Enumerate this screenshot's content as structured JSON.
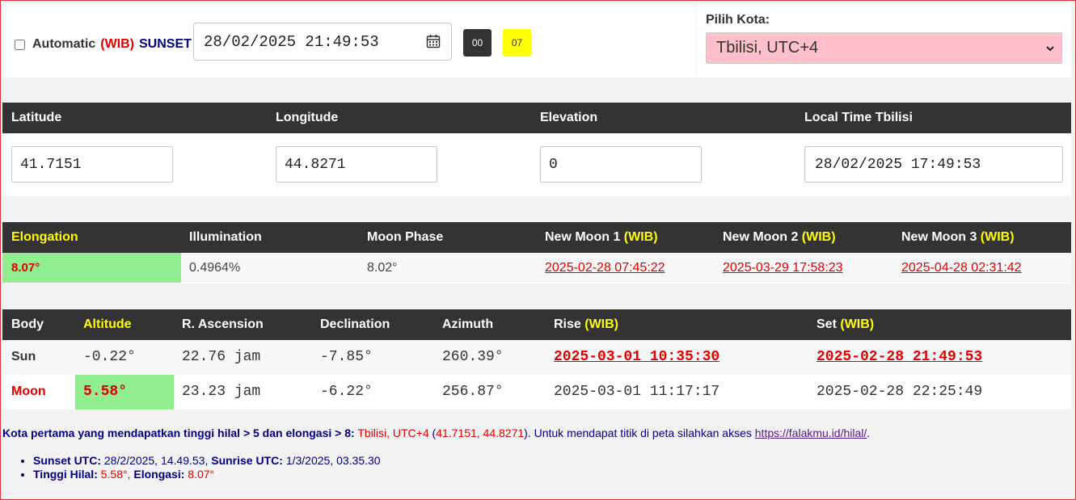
{
  "controls": {
    "automatic_label": "Automatic",
    "wib_label": "(WIB)",
    "sunset_label": "SUNSET",
    "datetime_value": "28/02/2025 21:49:53",
    "btn_00": "00",
    "btn_07": "07",
    "city_label": "Pilih Kota:",
    "city_selected": "Tbilisi, UTC+4"
  },
  "location": {
    "latitude_label": "Latitude",
    "longitude_label": "Longitude",
    "elevation_label": "Elevation",
    "local_time_label": "Local Time Tbilisi",
    "latitude": "41.7151",
    "longitude": "44.8271",
    "elevation": "0",
    "local_time": "28/02/2025 17:49:53"
  },
  "moon_table": {
    "headers": {
      "elongation": "Elongation",
      "illumination": "Illumination",
      "phase": "Moon Phase",
      "nm1": "New Moon 1",
      "nm2": "New Moon 2",
      "nm3": "New Moon 3",
      "wib": "(WIB)"
    },
    "elongation": "8.07°",
    "illumination": "0.4964%",
    "phase": "8.02°",
    "nm1": "2025-02-28 07:45:22",
    "nm2": "2025-03-29 17:58:23",
    "nm3": "2025-04-28 02:31:42"
  },
  "body_table": {
    "headers": {
      "body": "Body",
      "altitude": "Altitude",
      "ra": "R. Ascension",
      "dec": "Declination",
      "azimuth": "Azimuth",
      "rise": "Rise",
      "set": "Set",
      "wib": "(WIB)"
    },
    "rows": [
      {
        "body": "Sun",
        "altitude": "-0.22°",
        "ra": "22.76 jam",
        "dec": "-7.85°",
        "azimuth": "260.39°",
        "rise": "2025-03-01 10:35:30",
        "set": "2025-02-28 21:49:53"
      },
      {
        "body": "Moon",
        "altitude": "5.58°",
        "ra": "23.23 jam",
        "dec": "-6.22°",
        "azimuth": "256.87°",
        "rise": "2025-03-01 11:17:17",
        "set": "2025-02-28 22:25:49"
      }
    ]
  },
  "info": {
    "lead": "Kota pertama yang mendapatkan tinggi hilal > 5 dan elongasi > 8:",
    "city": "Tbilisi, UTC+4",
    "paren_open": "(",
    "coords": "41.7151, 44.8271",
    "after_coords": "). Untuk mendapat titik di peta silahkan akses",
    "link": "https://falakmu.id/hilal/",
    "period": ".",
    "sunset_utc_label": "Sunset UTC:",
    "sunset_utc": "28/2/2025, 14.49.53,",
    "sunrise_utc_label": "Sunrise UTC:",
    "sunrise_utc": "1/3/2025, 03.35.30",
    "tinggi_label": "Tinggi Hilal:",
    "tinggi": "5.58°,",
    "elongasi_label": "Elongasi:",
    "elongasi": "8.07°"
  },
  "colors": {
    "header_bg": "#333333",
    "accent_yellow": "#ffff00",
    "highlight_green": "#90ee90",
    "alert_red": "#e00000",
    "select_pink": "#ffc0cb",
    "navy": "#000080"
  }
}
